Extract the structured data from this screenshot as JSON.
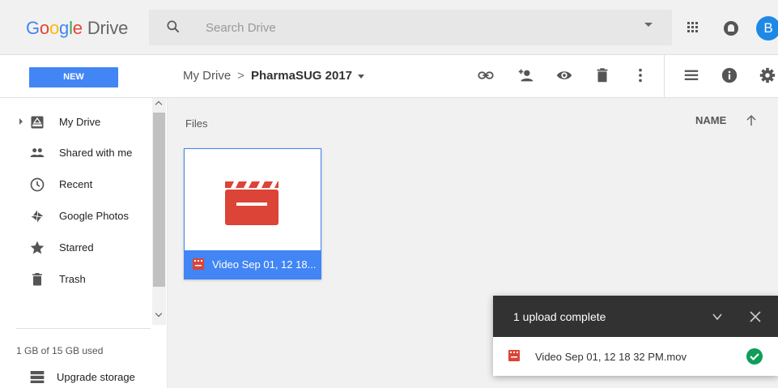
{
  "logo": {
    "google": "Google",
    "drive": "Drive"
  },
  "search": {
    "placeholder": "Search Drive"
  },
  "user": {
    "avatar_letter": "B"
  },
  "toolbar": {
    "new_label": "NEW",
    "breadcrumb": {
      "root": "My Drive",
      "separator": ">",
      "current": "PharmaSUG 2017"
    },
    "icons": [
      "link-icon",
      "add-person-icon",
      "eye-icon",
      "trash-icon",
      "more-vert-icon",
      "list-view-icon",
      "info-icon",
      "settings-icon"
    ]
  },
  "sidebar": {
    "items": [
      {
        "label": "My Drive",
        "icon": "my-drive-icon"
      },
      {
        "label": "Shared with me",
        "icon": "shared-people-icon"
      },
      {
        "label": "Recent",
        "icon": "clock-icon"
      },
      {
        "label": "Google Photos",
        "icon": "photos-pinwheel-icon"
      },
      {
        "label": "Starred",
        "icon": "star-icon"
      },
      {
        "label": "Trash",
        "icon": "trash-icon"
      }
    ],
    "storage": "1 GB of 15 GB used",
    "upgrade": "Upgrade storage"
  },
  "main": {
    "section_label": "Files",
    "sort_label": "NAME",
    "files": [
      {
        "name": "Video Sep 01, 12 18...",
        "type": "video"
      }
    ]
  },
  "upload_toast": {
    "title": "1 upload complete",
    "file_name": "Video Sep 01, 12 18 32 PM.mov",
    "status": "complete"
  },
  "colors": {
    "brand_blue": "#4285f4",
    "video_red": "#db4437",
    "success_green": "#0f9d58",
    "toast_dark": "#323232"
  }
}
